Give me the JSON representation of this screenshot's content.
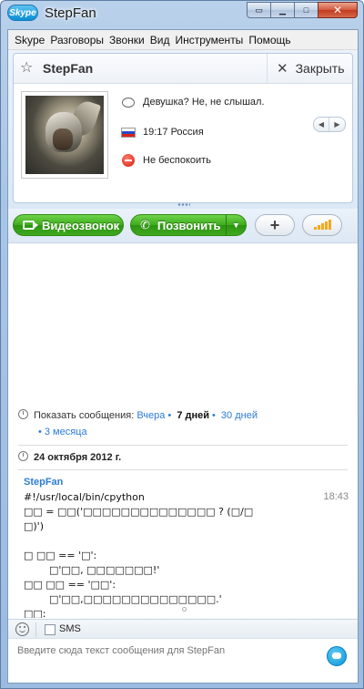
{
  "window": {
    "app_logo": "Skype",
    "title": "StepFan"
  },
  "menu": [
    "Skype",
    "Разговоры",
    "Звонки",
    "Вид",
    "Инструменты",
    "Помощь"
  ],
  "contact": {
    "name": "StepFan",
    "close_label": "Закрыть",
    "mood": "Девушка? Не, не слышал.",
    "local_time": "19:17 Россия",
    "status": "Не беспокоить"
  },
  "toolbar": {
    "video_label": "Видеозвонок",
    "call_label": "Позвонить",
    "add_label": "+"
  },
  "history": {
    "prefix": "Показать сообщения:",
    "yesterday": "Вчера",
    "seven_days": "7 дней",
    "thirty_days": "30 дней",
    "three_months": "3 месяца"
  },
  "chat": {
    "date": "24 октября 2012 г.",
    "sender": "StepFan",
    "time": "18:43",
    "lines": [
      "#!/usr/local/bin/cpython",
      "□□ = □□('□□□□□□□□□□□□□□ ? (□/□",
      "□)')",
      "",
      "□ □□ == '□':",
      "        □'□□, □□□□□□□!'",
      "□□ □□ == '□□':",
      "        □'□□,□□□□□□□□□□□□□□.'",
      "□□:",
      "        □'□□□□□□□□□.'"
    ]
  },
  "input": {
    "sms_label": "SMS",
    "placeholder": "Введите сюда текст сообщения для StepFan"
  }
}
